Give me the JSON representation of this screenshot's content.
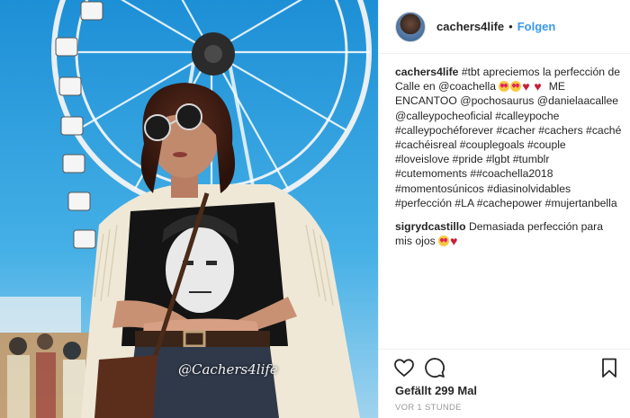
{
  "post": {
    "username": "cachers4life",
    "follow_label": "Folgen",
    "separator": "•",
    "watermark": "@Cachers4life"
  },
  "comments": [
    {
      "username": "cachers4life",
      "segments": [
        {
          "text": "#tbt apreciemos la perfección de Calle en @coachella "
        },
        {
          "emoji": "heart-eyes-emoji"
        },
        {
          "emoji": "heart-eyes-emoji"
        },
        {
          "emoji": "red-heart-emoji"
        },
        {
          "emoji": "red-heart-emoji"
        },
        {
          "text": " ME ENCANTOO @pochosaurus @danielaacallee @calleypocheoficial #calleypoche #calleypochéforever #cacher #cachers #caché #cachéisreal #couplegoals #couple #loveislove #pride #lgbt #tumblr #cutemoments ##coachella2018 #momentosúnicos #diasinolvidables #perfección #LA #cachepower #mujertanbella"
        }
      ]
    },
    {
      "username": "sigrydcastillo",
      "segments": [
        {
          "text": "Demasiada perfección para mis ojos "
        },
        {
          "emoji": "heart-eyes-emoji"
        },
        {
          "emoji": "red-heart-emoji"
        }
      ]
    }
  ],
  "actions": {
    "like_icon": "heart-outline-icon",
    "comment_icon": "speech-bubble-icon",
    "save_icon": "bookmark-icon"
  },
  "likes_text": "Gefällt 299 Mal",
  "timestamp": "VOR 1 STUNDE",
  "colors": {
    "follow_blue": "#3897f0",
    "border": "#efefef",
    "text": "#262626",
    "muted": "#999999",
    "sky": "#2a9bd8"
  }
}
